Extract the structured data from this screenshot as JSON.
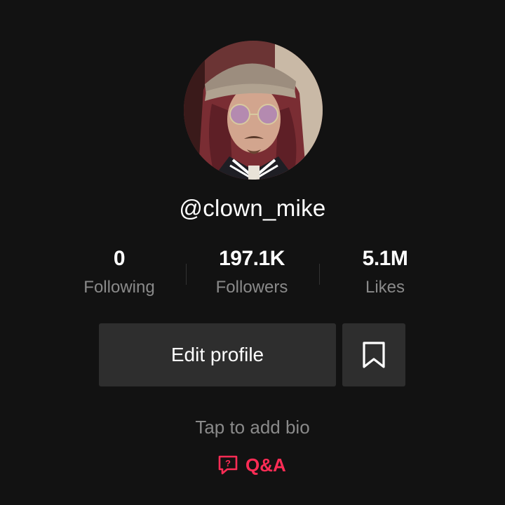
{
  "profile": {
    "username": "@clown_mike",
    "bio_placeholder": "Tap to add bio"
  },
  "stats": {
    "following": {
      "value": "0",
      "label": "Following"
    },
    "followers": {
      "value": "197.1K",
      "label": "Followers"
    },
    "likes": {
      "value": "5.1M",
      "label": "Likes"
    }
  },
  "actions": {
    "edit_profile_label": "Edit profile",
    "bookmark_icon": "bookmark-icon"
  },
  "qa": {
    "label": "Q&A",
    "icon": "question-chat-icon",
    "color": "#fe2c55"
  },
  "colors": {
    "background": "#121212",
    "button_bg": "#2e2e2e",
    "muted_text": "#8a8a8a",
    "accent": "#fe2c55"
  }
}
